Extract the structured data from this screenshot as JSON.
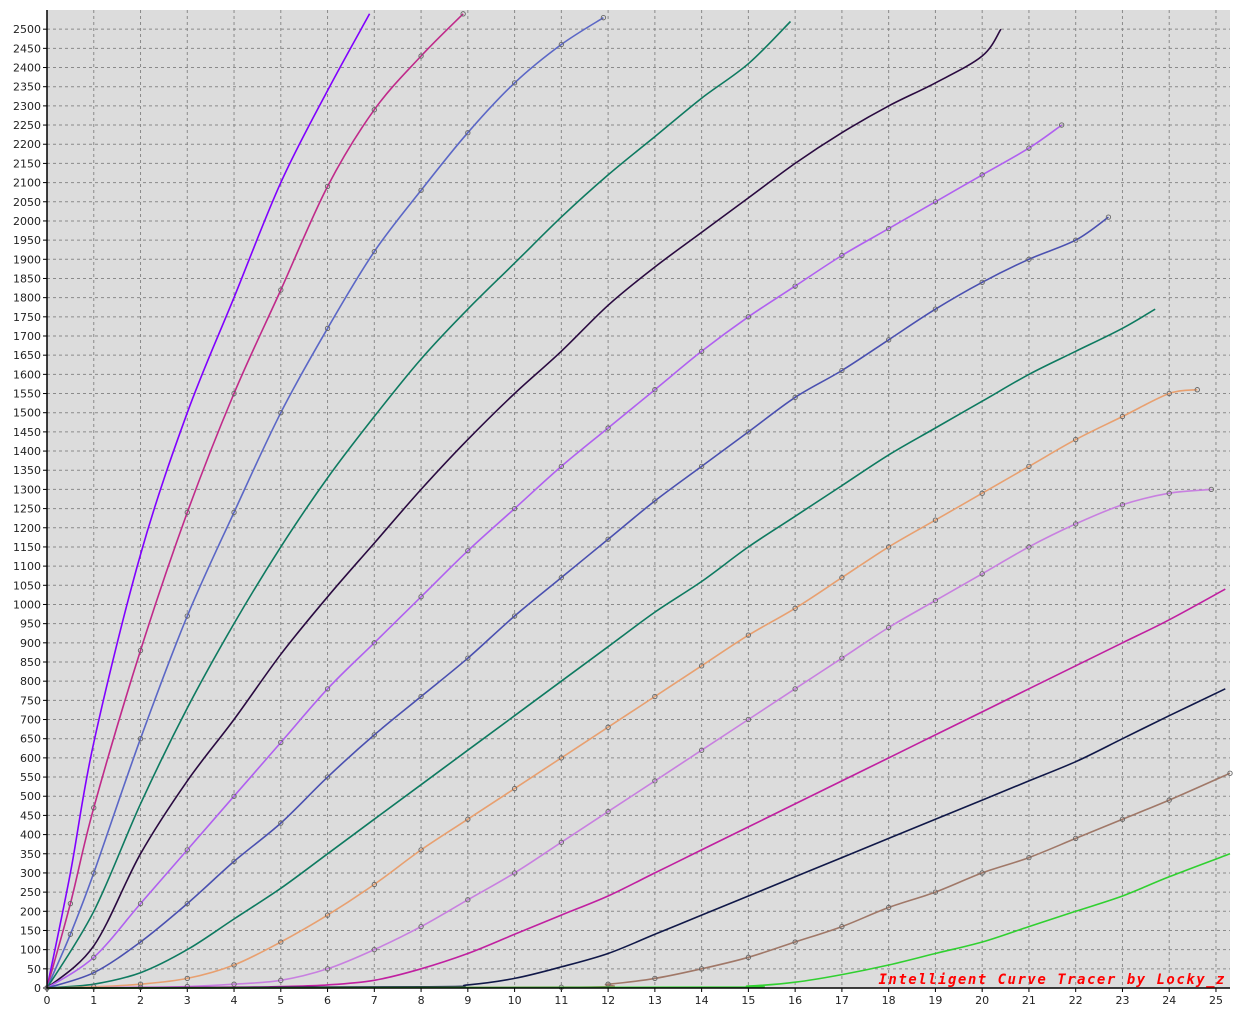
{
  "colors": {
    "plot_background": "#dcdcdc",
    "page_background": "#ffffff",
    "grid": "#8a8a8a",
    "axis": "#000000",
    "watermark": "#ff0000"
  },
  "watermark": "Intelligent Curve Tracer by Locky_z",
  "chart_data": {
    "type": "line",
    "title": "",
    "xlabel": "",
    "ylabel": "",
    "xlim": [
      0,
      25.3
    ],
    "ylim": [
      0,
      2550
    ],
    "x_ticks": [
      0,
      1,
      2,
      3,
      4,
      5,
      6,
      7,
      8,
      9,
      10,
      11,
      12,
      13,
      14,
      15,
      16,
      17,
      18,
      19,
      20,
      21,
      22,
      23,
      24,
      25
    ],
    "y_ticks": [
      0,
      50,
      100,
      150,
      200,
      250,
      300,
      350,
      400,
      450,
      500,
      550,
      600,
      650,
      700,
      750,
      800,
      850,
      900,
      950,
      1000,
      1050,
      1100,
      1150,
      1200,
      1250,
      1300,
      1350,
      1400,
      1450,
      1500,
      1550,
      1600,
      1650,
      1700,
      1750,
      1800,
      1850,
      1900,
      1950,
      2000,
      2050,
      2100,
      2150,
      2200,
      2250,
      2300,
      2350,
      2400,
      2450,
      2500
    ],
    "grid": true,
    "legend": "none",
    "series": [
      {
        "color": "#8000ff",
        "markers": false,
        "points": [
          [
            0,
            0
          ],
          [
            0.5,
            300
          ],
          [
            1,
            640
          ],
          [
            2,
            1130
          ],
          [
            3,
            1500
          ],
          [
            4,
            1800
          ],
          [
            5,
            2100
          ],
          [
            6,
            2340
          ],
          [
            6.9,
            2540
          ]
        ]
      },
      {
        "color": "#c02a8a",
        "markers": true,
        "points": [
          [
            0,
            0
          ],
          [
            0.5,
            220
          ],
          [
            1,
            470
          ],
          [
            2,
            880
          ],
          [
            3,
            1240
          ],
          [
            4,
            1550
          ],
          [
            5,
            1820
          ],
          [
            6,
            2090
          ],
          [
            7,
            2290
          ],
          [
            8,
            2430
          ],
          [
            8.9,
            2540
          ]
        ]
      },
      {
        "color": "#5b67c6",
        "markers": true,
        "points": [
          [
            0,
            0
          ],
          [
            0.5,
            140
          ],
          [
            1,
            300
          ],
          [
            2,
            650
          ],
          [
            3,
            970
          ],
          [
            4,
            1240
          ],
          [
            5,
            1500
          ],
          [
            6,
            1720
          ],
          [
            7,
            1920
          ],
          [
            8,
            2080
          ],
          [
            9,
            2230
          ],
          [
            10,
            2360
          ],
          [
            11,
            2460
          ],
          [
            11.9,
            2530
          ]
        ]
      },
      {
        "color": "#0e7a60",
        "markers": false,
        "points": [
          [
            0,
            0
          ],
          [
            1,
            200
          ],
          [
            2,
            480
          ],
          [
            3,
            730
          ],
          [
            4,
            950
          ],
          [
            5,
            1150
          ],
          [
            6,
            1330
          ],
          [
            7,
            1490
          ],
          [
            8,
            1640
          ],
          [
            9,
            1770
          ],
          [
            10,
            1890
          ],
          [
            11,
            2010
          ],
          [
            12,
            2120
          ],
          [
            13,
            2220
          ],
          [
            14,
            2320
          ],
          [
            15,
            2410
          ],
          [
            15.9,
            2520
          ]
        ]
      },
      {
        "color": "#2a0a40",
        "markers": false,
        "points": [
          [
            0,
            0
          ],
          [
            1,
            110
          ],
          [
            2,
            350
          ],
          [
            3,
            540
          ],
          [
            4,
            700
          ],
          [
            5,
            870
          ],
          [
            6,
            1020
          ],
          [
            7,
            1160
          ],
          [
            8,
            1300
          ],
          [
            9,
            1430
          ],
          [
            10,
            1550
          ],
          [
            11,
            1660
          ],
          [
            12,
            1780
          ],
          [
            13,
            1880
          ],
          [
            14,
            1970
          ],
          [
            15,
            2060
          ],
          [
            16,
            2150
          ],
          [
            17,
            2230
          ],
          [
            18,
            2300
          ],
          [
            19,
            2360
          ],
          [
            20,
            2430
          ],
          [
            20.4,
            2500
          ]
        ]
      },
      {
        "color": "#b060f0",
        "markers": true,
        "points": [
          [
            0,
            0
          ],
          [
            1,
            80
          ],
          [
            2,
            220
          ],
          [
            3,
            360
          ],
          [
            4,
            500
          ],
          [
            5,
            640
          ],
          [
            6,
            780
          ],
          [
            7,
            900
          ],
          [
            8,
            1020
          ],
          [
            9,
            1140
          ],
          [
            10,
            1250
          ],
          [
            11,
            1360
          ],
          [
            12,
            1460
          ],
          [
            13,
            1560
          ],
          [
            14,
            1660
          ],
          [
            15,
            1750
          ],
          [
            16,
            1830
          ],
          [
            17,
            1910
          ],
          [
            18,
            1980
          ],
          [
            19,
            2050
          ],
          [
            20,
            2120
          ],
          [
            21,
            2190
          ],
          [
            21.7,
            2250
          ]
        ]
      },
      {
        "color": "#4a50b0",
        "markers": true,
        "points": [
          [
            0,
            0
          ],
          [
            1,
            40
          ],
          [
            2,
            120
          ],
          [
            3,
            220
          ],
          [
            4,
            330
          ],
          [
            5,
            430
          ],
          [
            6,
            550
          ],
          [
            7,
            660
          ],
          [
            8,
            760
          ],
          [
            9,
            860
          ],
          [
            10,
            970
          ],
          [
            11,
            1070
          ],
          [
            12,
            1170
          ],
          [
            13,
            1270
          ],
          [
            14,
            1360
          ],
          [
            15,
            1450
          ],
          [
            16,
            1540
          ],
          [
            17,
            1610
          ],
          [
            18,
            1690
          ],
          [
            19,
            1770
          ],
          [
            20,
            1840
          ],
          [
            21,
            1900
          ],
          [
            22,
            1950
          ],
          [
            22.7,
            2010
          ]
        ]
      },
      {
        "color": "#0e7a60",
        "markers": false,
        "points": [
          [
            0,
            0
          ],
          [
            1,
            10
          ],
          [
            2,
            40
          ],
          [
            3,
            100
          ],
          [
            4,
            180
          ],
          [
            5,
            260
          ],
          [
            6,
            350
          ],
          [
            7,
            440
          ],
          [
            8,
            530
          ],
          [
            9,
            620
          ],
          [
            10,
            710
          ],
          [
            11,
            800
          ],
          [
            12,
            890
          ],
          [
            13,
            980
          ],
          [
            14,
            1060
          ],
          [
            15,
            1150
          ],
          [
            16,
            1230
          ],
          [
            17,
            1310
          ],
          [
            18,
            1390
          ],
          [
            19,
            1460
          ],
          [
            20,
            1530
          ],
          [
            21,
            1600
          ],
          [
            22,
            1660
          ],
          [
            23,
            1720
          ],
          [
            23.7,
            1770
          ]
        ]
      },
      {
        "color": "#e8a070",
        "markers": true,
        "points": [
          [
            0,
            0
          ],
          [
            1,
            3
          ],
          [
            2,
            10
          ],
          [
            3,
            25
          ],
          [
            4,
            60
          ],
          [
            5,
            120
          ],
          [
            6,
            190
          ],
          [
            7,
            270
          ],
          [
            8,
            360
          ],
          [
            9,
            440
          ],
          [
            10,
            520
          ],
          [
            11,
            600
          ],
          [
            12,
            680
          ],
          [
            13,
            760
          ],
          [
            14,
            840
          ],
          [
            15,
            920
          ],
          [
            16,
            990
          ],
          [
            17,
            1070
          ],
          [
            18,
            1150
          ],
          [
            19,
            1220
          ],
          [
            20,
            1290
          ],
          [
            21,
            1360
          ],
          [
            22,
            1430
          ],
          [
            23,
            1490
          ],
          [
            24,
            1550
          ],
          [
            24.6,
            1560
          ]
        ]
      },
      {
        "color": "#c880e0",
        "markers": true,
        "points": [
          [
            0,
            0
          ],
          [
            2,
            2
          ],
          [
            3,
            4
          ],
          [
            4,
            10
          ],
          [
            5,
            20
          ],
          [
            6,
            50
          ],
          [
            7,
            100
          ],
          [
            8,
            160
          ],
          [
            9,
            230
          ],
          [
            10,
            300
          ],
          [
            11,
            380
          ],
          [
            12,
            460
          ],
          [
            13,
            540
          ],
          [
            14,
            620
          ],
          [
            15,
            700
          ],
          [
            16,
            780
          ],
          [
            17,
            860
          ],
          [
            18,
            940
          ],
          [
            19,
            1010
          ],
          [
            20,
            1080
          ],
          [
            21,
            1150
          ],
          [
            22,
            1210
          ],
          [
            23,
            1260
          ],
          [
            24,
            1290
          ],
          [
            24.9,
            1300
          ]
        ]
      },
      {
        "color": "#c020a0",
        "markers": false,
        "points": [
          [
            0,
            0
          ],
          [
            4,
            2
          ],
          [
            5,
            4
          ],
          [
            6,
            8
          ],
          [
            7,
            20
          ],
          [
            8,
            50
          ],
          [
            9,
            90
          ],
          [
            10,
            140
          ],
          [
            11,
            190
          ],
          [
            12,
            240
          ],
          [
            13,
            300
          ],
          [
            14,
            360
          ],
          [
            15,
            420
          ],
          [
            16,
            480
          ],
          [
            17,
            540
          ],
          [
            18,
            600
          ],
          [
            19,
            660
          ],
          [
            20,
            720
          ],
          [
            21,
            780
          ],
          [
            22,
            840
          ],
          [
            23,
            900
          ],
          [
            24,
            960
          ],
          [
            25.2,
            1040
          ]
        ]
      },
      {
        "color": "#101848",
        "markers": false,
        "points": [
          [
            0,
            0
          ],
          [
            8,
            3
          ],
          [
            9,
            8
          ],
          [
            10,
            25
          ],
          [
            11,
            55
          ],
          [
            12,
            90
          ],
          [
            13,
            140
          ],
          [
            14,
            190
          ],
          [
            15,
            240
          ],
          [
            16,
            290
          ],
          [
            17,
            340
          ],
          [
            18,
            390
          ],
          [
            19,
            440
          ],
          [
            20,
            490
          ],
          [
            21,
            540
          ],
          [
            22,
            590
          ],
          [
            23,
            650
          ],
          [
            24,
            710
          ],
          [
            25.2,
            780
          ]
        ]
      },
      {
        "color": "#a07868",
        "markers": true,
        "points": [
          [
            0,
            0
          ],
          [
            11,
            2
          ],
          [
            12,
            10
          ],
          [
            13,
            25
          ],
          [
            14,
            50
          ],
          [
            15,
            80
          ],
          [
            16,
            120
          ],
          [
            17,
            160
          ],
          [
            18,
            210
          ],
          [
            19,
            250
          ],
          [
            20,
            300
          ],
          [
            21,
            340
          ],
          [
            22,
            390
          ],
          [
            23,
            440
          ],
          [
            24,
            490
          ],
          [
            25.3,
            560
          ]
        ]
      },
      {
        "color": "#30d030",
        "markers": false,
        "points": [
          [
            0,
            0
          ],
          [
            14,
            2
          ],
          [
            15,
            5
          ],
          [
            16,
            15
          ],
          [
            17,
            35
          ],
          [
            18,
            60
          ],
          [
            19,
            90
          ],
          [
            20,
            120
          ],
          [
            21,
            160
          ],
          [
            22,
            200
          ],
          [
            23,
            240
          ],
          [
            24,
            290
          ],
          [
            25.3,
            350
          ]
        ]
      }
    ]
  }
}
